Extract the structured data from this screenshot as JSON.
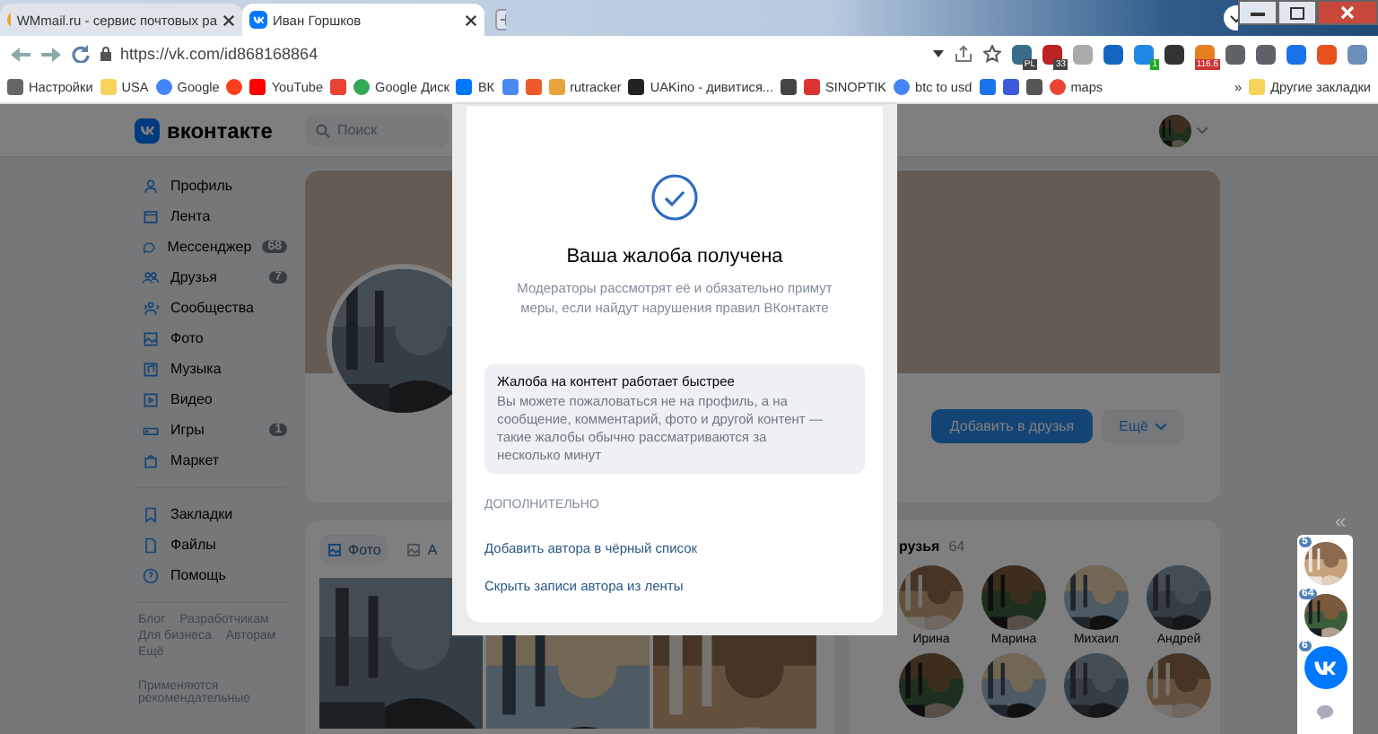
{
  "browser": {
    "tabs": [
      {
        "title": "WMmail.ru - сервис почтовых ра",
        "kind": "wmmail",
        "selected": false
      },
      {
        "title": "Иван Горшков",
        "kind": "vk",
        "selected": true
      }
    ],
    "url": "https://vk.com/id868168864",
    "extensions": [
      {
        "kind": "globe",
        "badge": "PL"
      },
      {
        "kind": "shield",
        "badge": "33"
      },
      {
        "kind": "doc"
      },
      {
        "kind": "v"
      },
      {
        "kind": "phone",
        "badge": "1"
      },
      {
        "kind": "dark"
      },
      {
        "kind": "rate",
        "badge": "116.6"
      },
      {
        "kind": "puzzle"
      },
      {
        "kind": "list"
      },
      {
        "kind": "download"
      },
      {
        "kind": "profile"
      },
      {
        "kind": "globe2"
      }
    ],
    "bookmarks": [
      {
        "kind": "gear",
        "label": "Настройки"
      },
      {
        "kind": "folder",
        "label": "USA"
      },
      {
        "kind": "google",
        "label": "Google"
      },
      {
        "kind": "yandex"
      },
      {
        "kind": "youtube",
        "label": "YouTube"
      },
      {
        "kind": "gmail"
      },
      {
        "kind": "drive",
        "label": "Google Диск"
      },
      {
        "kind": "vk",
        "label": "ВК"
      },
      {
        "kind": "translate"
      },
      {
        "kind": "f"
      },
      {
        "kind": "rutracker",
        "label": "rutracker"
      },
      {
        "kind": "uakino",
        "label": "UAKino - дивитися..."
      },
      {
        "kind": "chess"
      },
      {
        "kind": "sinoptik",
        "label": "SINOPTIK"
      },
      {
        "kind": "google",
        "label": "btc to usd"
      },
      {
        "kind": "p"
      },
      {
        "kind": "arrow"
      },
      {
        "kind": "gc"
      },
      {
        "kind": "maps",
        "label": "maps"
      }
    ],
    "more_bookmarks": "»",
    "other_bookmarks": "Другие закладки"
  },
  "vk": {
    "logo": "вконтакте",
    "search": {
      "placeholder": "Поиск"
    },
    "nav": [
      {
        "label": "Профиль",
        "kind": "user"
      },
      {
        "label": "Лента",
        "kind": "feed"
      },
      {
        "label": "Мессенджер",
        "kind": "chat",
        "count": "68"
      },
      {
        "label": "Друзья",
        "kind": "friends",
        "count": "7"
      },
      {
        "label": "Сообщества",
        "kind": "groups"
      },
      {
        "label": "Фото"
      },
      {
        "label": "Музыка",
        "kind": "music"
      },
      {
        "label": "Видео",
        "kind": "video"
      },
      {
        "label": "Игры",
        "kind": "games",
        "count": "1"
      },
      {
        "label": "Маркет",
        "kind": "bag"
      }
    ],
    "nav2": [
      {
        "label": "Закладки",
        "kind": "bookmark"
      },
      {
        "label": "Файлы",
        "kind": "file"
      },
      {
        "label": "Помощь",
        "kind": "help"
      }
    ],
    "footer_links": [
      "Блог",
      "Разработчикам",
      "Для бизнеса",
      "Авторам",
      "Ещё"
    ],
    "footer_note": "Применяются рекомендательные",
    "profile": {
      "add_button": "Добавить в друзья",
      "more_button": "Ещё"
    },
    "media_tabs": [
      {
        "label": "Фото",
        "selected": true
      },
      {
        "label": "А",
        "selected": false
      }
    ],
    "friends": {
      "title": "рузья",
      "count": "64",
      "people": [
        "Ирина",
        "Марина",
        "Михаил",
        "Андрей"
      ]
    },
    "side_chats": [
      {
        "badge": "5",
        "kind": "picture"
      },
      {
        "badge": "64",
        "kind": "picture"
      },
      {
        "badge": "6",
        "kind": "vk"
      }
    ],
    "collapse": "«"
  },
  "modal": {
    "title": "Ваша жалоба получена",
    "text": "Модераторы рассмотрят её и обязательно примут меры, если найдут нарушения правил ВКонтакте",
    "info": {
      "title": "Жалоба на контент работает быстрее",
      "text": "Вы можете пожаловаться не на профиль, а на сообщение, комментарий, фото и другой контент — такие жалобы обычно рассматриваются за несколько минут"
    },
    "section": "ДОПОЛНИТЕЛЬНО",
    "links": [
      "Добавить автора в чёрный список",
      "Скрыть записи автора из ленты"
    ]
  }
}
